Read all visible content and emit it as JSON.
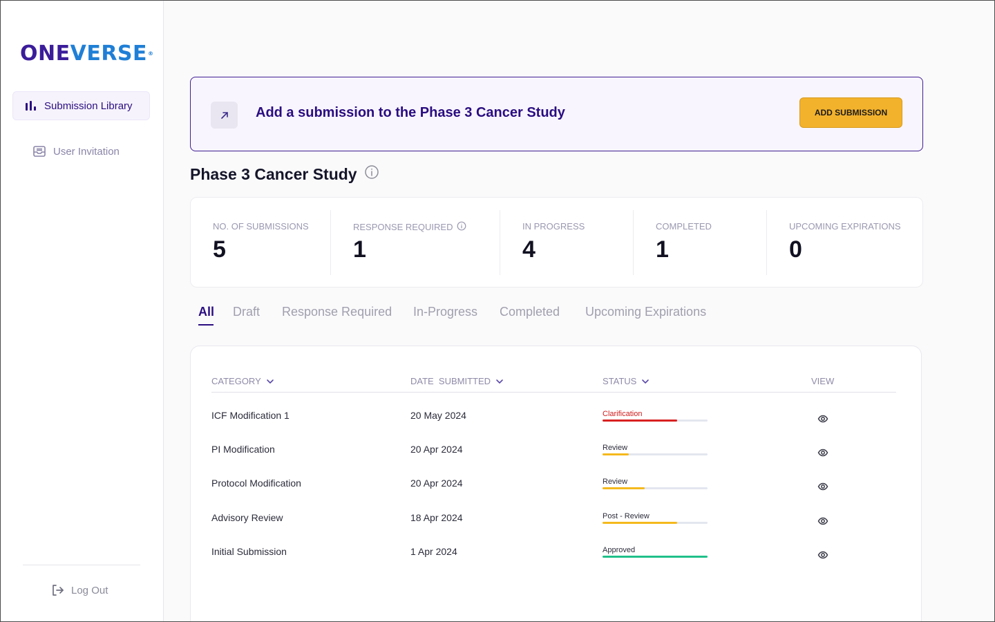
{
  "brand": {
    "name_part1": "ONE",
    "name_part2": "VERSE",
    "reg_mark": "®"
  },
  "sidebar": {
    "items": [
      {
        "label": "Submission Library",
        "icon": "bar-chart-icon",
        "active": true
      },
      {
        "label": "User Invitation",
        "icon": "inbox-icon",
        "active": false
      }
    ],
    "logout_label": "Log Out"
  },
  "banner": {
    "title": "Add a submission to the Phase 3 Cancer Study",
    "button_label": "ADD SUBMISSION",
    "icon": "arrow-up-right-icon"
  },
  "study": {
    "title": "Phase 3 Cancer Study",
    "info_icon": "info-icon"
  },
  "stats": [
    {
      "label": "NO. OF SUBMISSIONS",
      "value": "5"
    },
    {
      "label": "RESPONSE REQUIRED",
      "value": "1",
      "info": true
    },
    {
      "label": "IN PROGRESS",
      "value": "4"
    },
    {
      "label": "COMPLETED",
      "value": "1"
    },
    {
      "label": "UPCOMING EXPIRATIONS",
      "value": "0"
    }
  ],
  "tabs": [
    {
      "label": "All",
      "active": true
    },
    {
      "label": "Draft"
    },
    {
      "label": "Response Required"
    },
    {
      "label": "In-Progress"
    },
    {
      "label": "Completed"
    },
    {
      "label": "Upcoming Expirations"
    }
  ],
  "table": {
    "columns": {
      "category": "CATEGORY",
      "date": "DATE  SUBMITTED",
      "status": "STATUS",
      "view": "VIEW"
    },
    "rows": [
      {
        "category": "ICF Modification 1",
        "date": "20 May 2024",
        "status": "Clarification",
        "progress": 0.71,
        "color": "#d92020",
        "text_color": "#d11a1a"
      },
      {
        "category": "PI Modification",
        "date": "20 Apr 2024",
        "status": "Review",
        "progress": 0.25,
        "color": "#f5b91c",
        "text_color": "#2b2b3b"
      },
      {
        "category": "Protocol Modification",
        "date": "20 Apr 2024",
        "status": "Review",
        "progress": 0.4,
        "color": "#f5b91c",
        "text_color": "#2b2b3b"
      },
      {
        "category": "Advisory Review",
        "date": "18 Apr 2024",
        "status": "Post - Review",
        "progress": 0.71,
        "color": "#f5b91c",
        "text_color": "#2b2b3b"
      },
      {
        "category": "Initial Submission",
        "date": "1 Apr 2024",
        "status": "Approved",
        "progress": 1.0,
        "color": "#20c08a",
        "text_color": "#2b2b3b"
      }
    ]
  }
}
